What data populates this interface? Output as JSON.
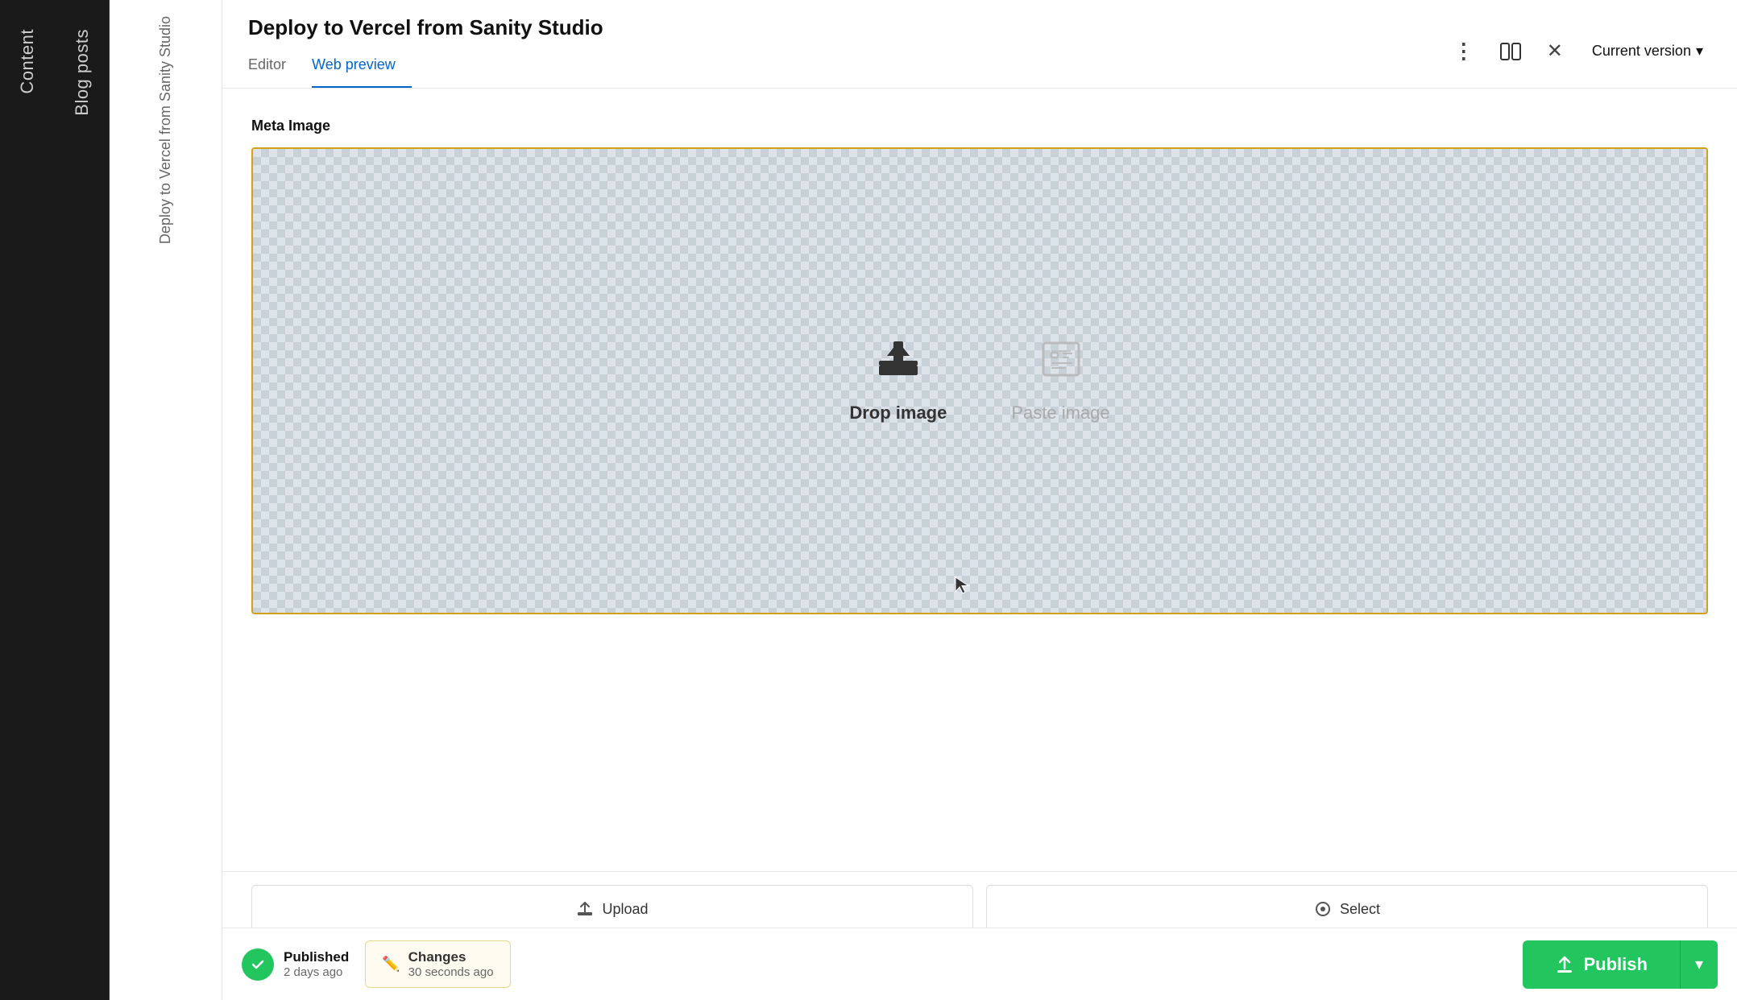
{
  "sidebar": {
    "strip1": {
      "label": "Content"
    },
    "strip2": {
      "label": "Blog posts"
    },
    "strip3": {
      "label": "Deploy to Vercel from Sanity Studio"
    }
  },
  "header": {
    "title": "Deploy to Vercel from Sanity Studio",
    "tabs": [
      {
        "label": "Editor",
        "active": false
      },
      {
        "label": "Web preview",
        "active": true
      }
    ],
    "version_selector": {
      "label": "Current version",
      "chevron": "▾"
    },
    "icons": {
      "more": "⋮",
      "split": "⊞",
      "close": "✕"
    }
  },
  "content": {
    "field_label": "Meta Image",
    "drop_zone": {
      "drop_label": "Drop image",
      "paste_label": "Paste image"
    },
    "buttons": {
      "upload_label": "Upload",
      "select_label": "Select"
    }
  },
  "footer": {
    "published": {
      "label": "Published",
      "time": "2 days ago"
    },
    "changes": {
      "label": "Changes",
      "time": "30 seconds ago"
    },
    "publish_button": "Publish",
    "chevron_down": "▾"
  }
}
